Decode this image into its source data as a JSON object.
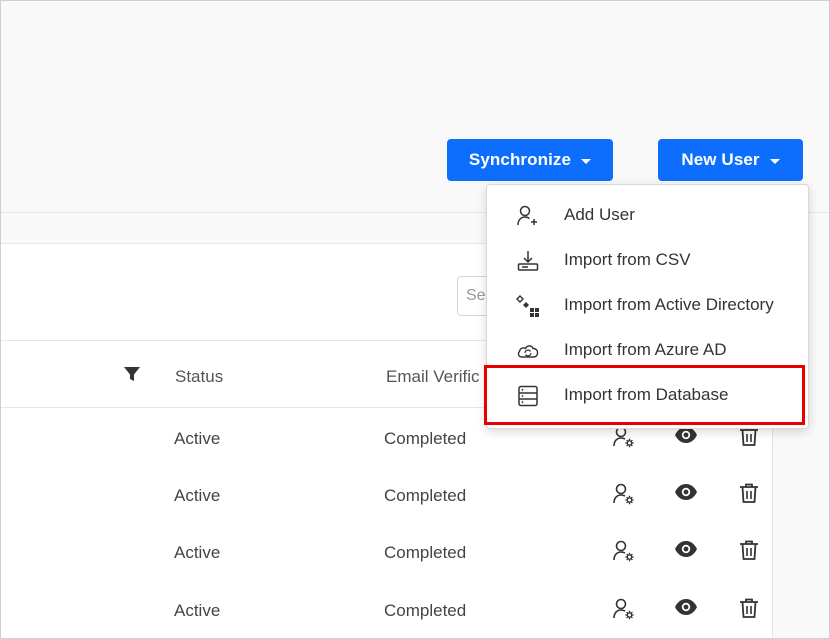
{
  "toolbar": {
    "synchronize_label": "Synchronize",
    "new_user_label": "New User"
  },
  "search": {
    "placeholder": "Se"
  },
  "table": {
    "columns": [
      "Status",
      "Email Verific"
    ],
    "rows": [
      {
        "status": "Active",
        "email_verification": "Completed"
      },
      {
        "status": "Active",
        "email_verification": "Completed"
      },
      {
        "status": "Active",
        "email_verification": "Completed"
      },
      {
        "status": "Active",
        "email_verification": "Completed"
      }
    ],
    "row_actions": [
      "user-settings-icon",
      "eye-icon",
      "trash-icon"
    ]
  },
  "new_user_menu": {
    "items": [
      {
        "label": "Add User",
        "icon": "add-user-icon"
      },
      {
        "label": "Import from CSV",
        "icon": "download-icon"
      },
      {
        "label": "Import from Active Directory",
        "icon": "active-directory-icon"
      },
      {
        "label": "Import from Azure AD",
        "icon": "cloud-sync-icon"
      },
      {
        "label": "Import from Database",
        "icon": "database-icon"
      }
    ],
    "highlighted_item": "Import from Database"
  },
  "colors": {
    "primary": "#0d6efd",
    "highlight": "#e60000",
    "background": "#f9f9f9"
  }
}
